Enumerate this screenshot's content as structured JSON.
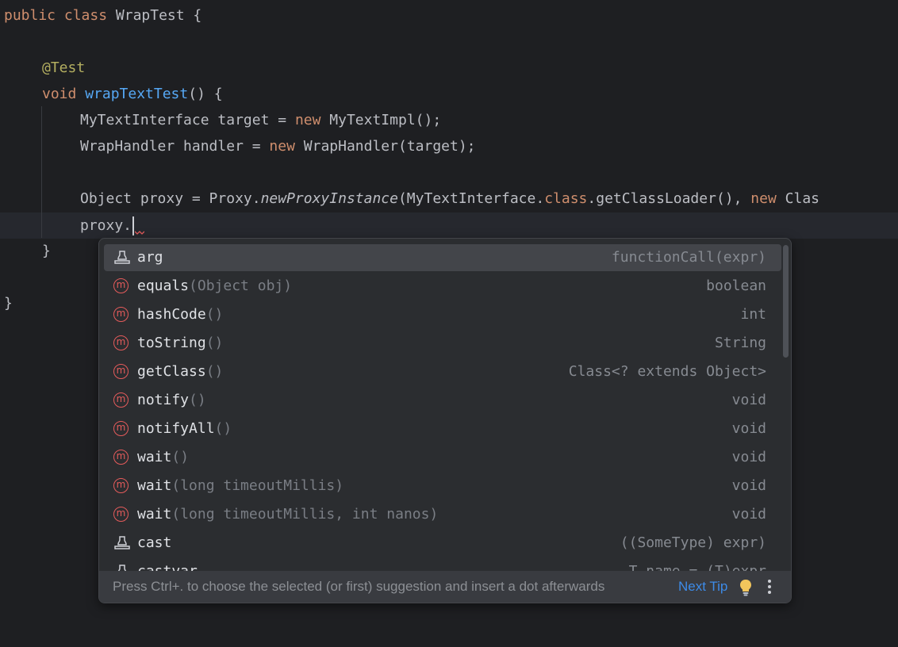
{
  "code": {
    "l1": {
      "kw": "public class ",
      "name": "WrapTest",
      "rest": " {"
    },
    "l2": {
      "ann": "@Test"
    },
    "l3": {
      "kw": "void ",
      "fn": "wrapTextTest",
      "rest": "() {"
    },
    "l4": {
      "a": "MyTextInterface target = ",
      "kw": "new",
      "b": " MyTextImpl();"
    },
    "l5": {
      "a": "WrapHandler handler = ",
      "kw": "new",
      "b": " WrapHandler(target);"
    },
    "l6": {
      "a": "Object proxy = Proxy.",
      "it": "newProxyInstance",
      "b": "(MyTextInterface.",
      "kw1": "class",
      "c": ".getClassLoader(), ",
      "kw2": "new",
      "d": " Clas"
    },
    "l7": {
      "text": "proxy."
    },
    "l8": {
      "text": "}"
    },
    "l9": {
      "text": "}"
    }
  },
  "completion": {
    "items": [
      {
        "icon": "template-icon",
        "name": "arg",
        "params": "",
        "type": "functionCall(expr)"
      },
      {
        "icon": "method-icon",
        "name": "equals",
        "params": "(Object obj)",
        "type": "boolean"
      },
      {
        "icon": "method-icon",
        "name": "hashCode",
        "params": "()",
        "type": "int"
      },
      {
        "icon": "method-icon",
        "name": "toString",
        "params": "()",
        "type": "String"
      },
      {
        "icon": "method-icon",
        "name": "getClass",
        "params": "()",
        "type": "Class<? extends Object>"
      },
      {
        "icon": "method-icon",
        "name": "notify",
        "params": "()",
        "type": "void"
      },
      {
        "icon": "method-icon",
        "name": "notifyAll",
        "params": "()",
        "type": "void"
      },
      {
        "icon": "method-icon",
        "name": "wait",
        "params": "()",
        "type": "void"
      },
      {
        "icon": "method-icon",
        "name": "wait",
        "params": "(long timeoutMillis)",
        "type": "void"
      },
      {
        "icon": "method-icon",
        "name": "wait",
        "params": "(long timeoutMillis, int nanos)",
        "type": "void"
      },
      {
        "icon": "template-icon",
        "name": "cast",
        "params": "",
        "type": "((SomeType) expr)"
      },
      {
        "icon": "template-icon",
        "name": "castvar",
        "params": "",
        "type": "T name = (T)expr"
      }
    ],
    "method_icon_letter": "m",
    "footer": {
      "hint": "Press Ctrl+. to choose the selected (or first) suggestion and insert a dot afterwards",
      "next_tip": "Next Tip"
    }
  },
  "colors": {
    "background": "#1e1f22",
    "keyword": "#cf8e6d",
    "annotation": "#b3ae60",
    "function": "#56a8f5",
    "method_icon": "#e55b5b",
    "link": "#3d8be8",
    "bulb": "#f2c55c"
  }
}
